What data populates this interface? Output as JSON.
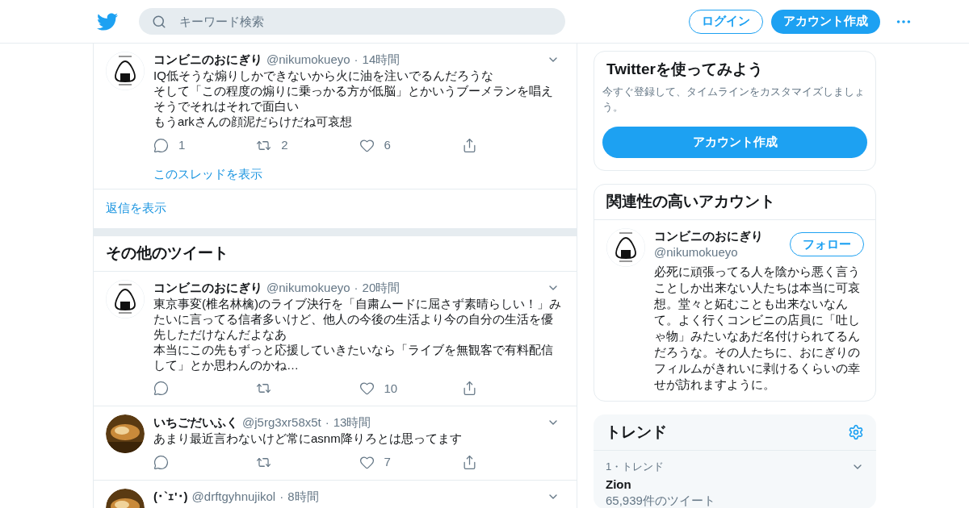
{
  "header": {
    "search": {
      "placeholder": "キーワード検索"
    },
    "login": "ログイン",
    "signup": "アカウント作成"
  },
  "thread_tweet": {
    "avatar": {
      "kind": "drawing"
    },
    "name": "コンビニのおにぎり",
    "handle": "@nikumokueyo",
    "dot": "·",
    "time": "14時間",
    "lines": [
      "IQ低そうな煽りしかできないから火に油を注いでるんだろうな",
      "そして「この程度の煽りに乗っかる方が低脳」とかいうブーメランを唱えそうでそれはそれで面白い",
      "もうarkさんの顔泥だらけだね可哀想"
    ],
    "replies": "1",
    "retweets": "2",
    "likes": "6",
    "show_thread": "このスレッドを表示"
  },
  "show_replies": "返信を表示",
  "more_tweets": {
    "title": "その他のツイート",
    "tweets": [
      {
        "avatar": {
          "kind": "drawing"
        },
        "name": "コンビニのおにぎり",
        "handle": "@nikumokueyo",
        "dot": "·",
        "time": "20時間",
        "lines": [
          "東京事変(椎名林檎)のライブ決行を「自粛ムードに屈さず素晴らしい！」みたいに言ってる信者多いけど、他人の今後の生活より今の自分の生活を優先しただけなんだよなあ",
          "本当にこの先もずっと応援していきたいなら「ライブを無観客で有料配信して」とか思わんのかね…"
        ],
        "likes": "10"
      },
      {
        "avatar": {
          "kind": "picture"
        },
        "name": "いちごだいふく",
        "handle": "@j5rg3xr58x5t",
        "dot": "·",
        "time": "13時間",
        "lines": [
          "あまり最近言わないけど常にasnm降りろとは思ってます"
        ],
        "likes": "7"
      },
      {
        "avatar": {
          "kind": "picture"
        },
        "name": "(･`ｪ'･)",
        "handle": "@drftgyhnujikol",
        "dot": "·",
        "time": "8時間"
      }
    ]
  },
  "sidebar": {
    "signup_card": {
      "title": "Twitterを使ってみよう",
      "text": "今すぐ登録して、タイムラインをカスタマイズしましょう。",
      "button": "アカウント作成"
    },
    "related": {
      "title": "関連性の高いアカウント",
      "account": {
        "avatar": {
          "kind": "drawing"
        },
        "name": "コンビニのおにぎり",
        "handle": "@nikumokueyo",
        "follow": "フォロー",
        "bio": "必死に頑張ってる人を陰から悪く言うことしか出来ない人たちは本当に可哀想。堂々と妬むことも出来ないなんて。よく行くコンビニの店員に「吐しゃ物」みたいなあだ名付けられてるんだろうな。その人たちに、おにぎりのフィルムがきれいに剥けるくらいの幸せが訪れますように。"
      }
    },
    "trends": {
      "title": "トレンド",
      "items": [
        {
          "rank": "1・トレンド",
          "name": "Zion",
          "count": "65,939件のツイート"
        }
      ]
    }
  }
}
